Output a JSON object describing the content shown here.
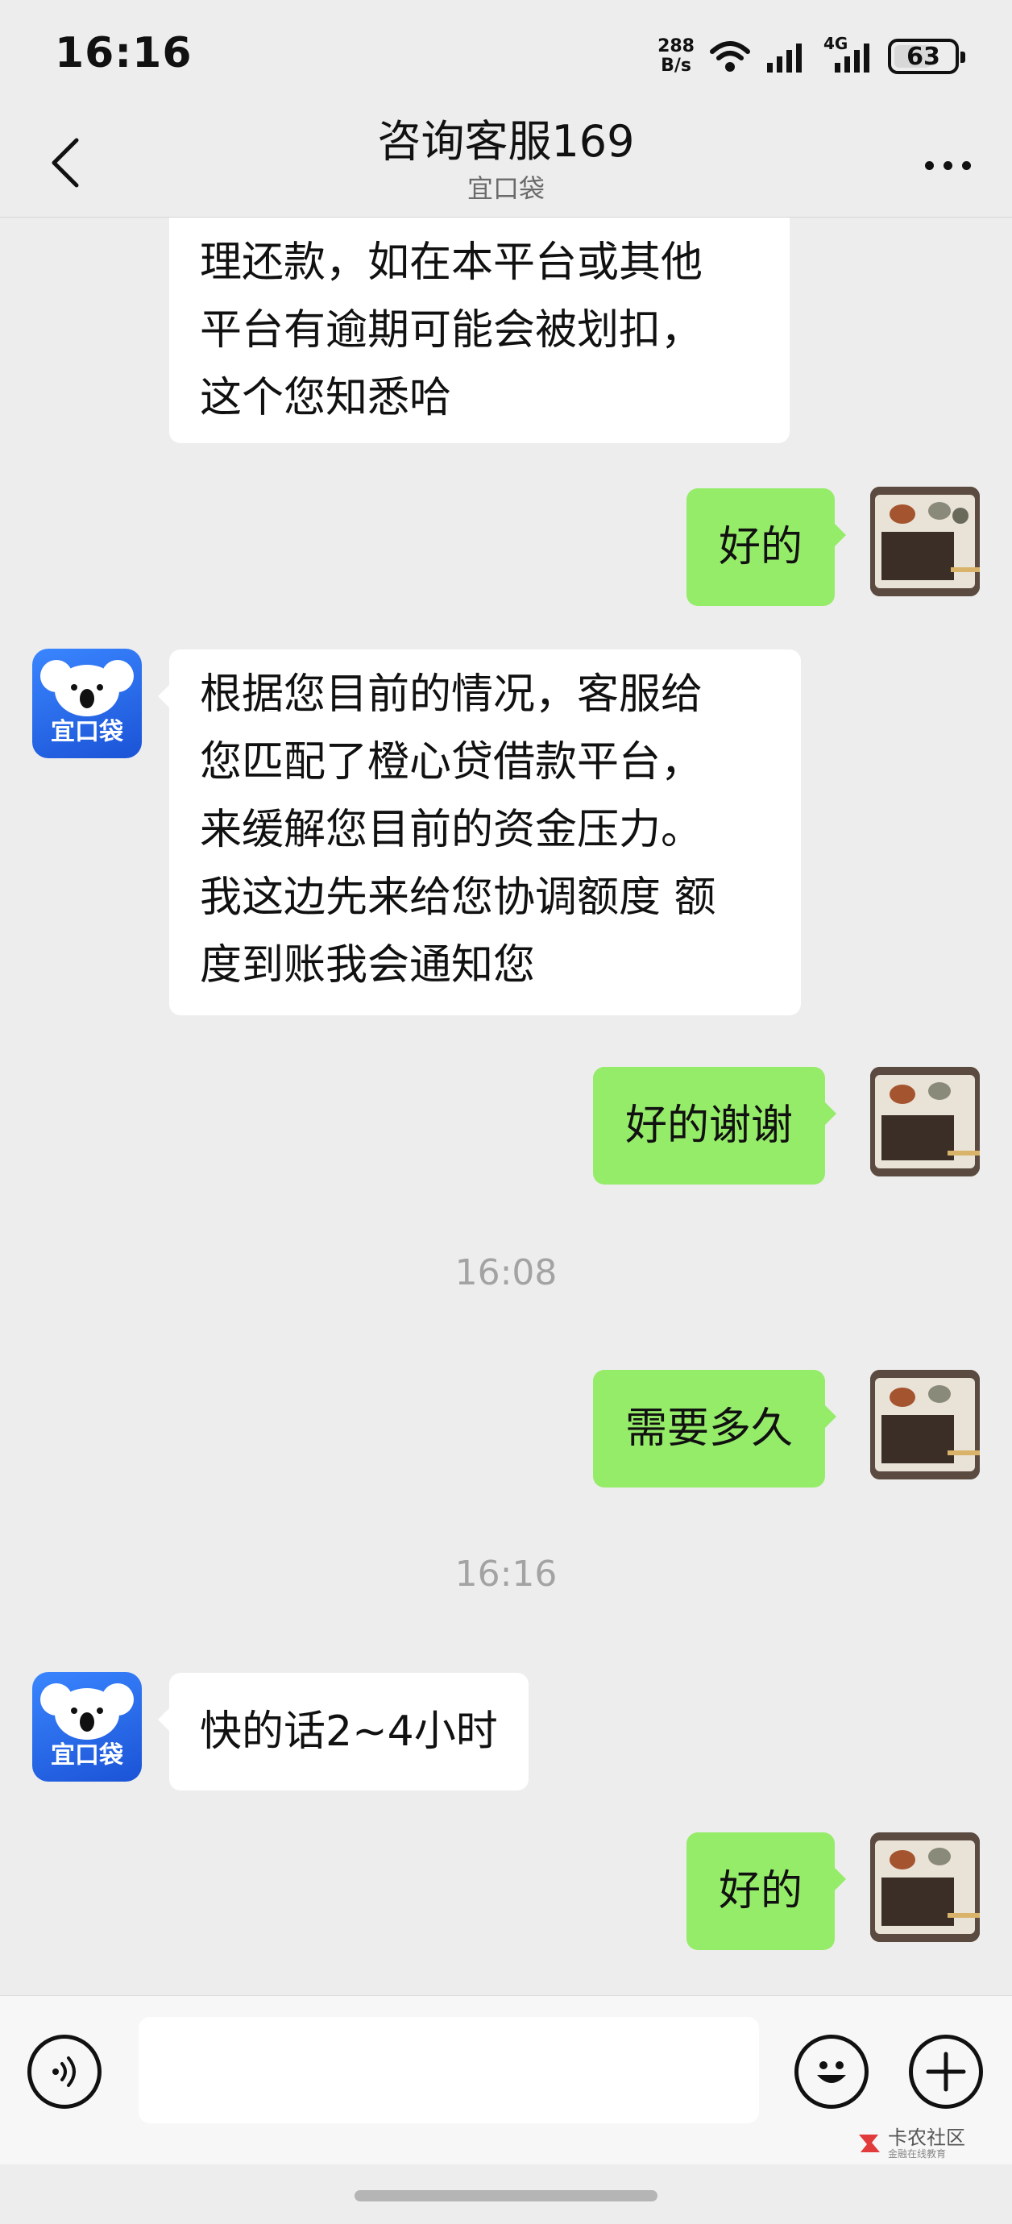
{
  "status_bar": {
    "time": "16:16",
    "net_speed_value": "288",
    "net_speed_unit": "B/s",
    "network_type": "4G",
    "battery_level": "63",
    "battery_fraction": 0.63
  },
  "nav": {
    "title": "咨询客服169",
    "subtitle": "宜口袋"
  },
  "brand": {
    "avatar_text": "宜口袋",
    "bubble_color_out": "#95ec69",
    "bubble_color_in": "#ffffff",
    "background": "#ededed"
  },
  "messages": [
    {
      "side": "in",
      "text": "理还款，如在本平台或其他\n平台有逾期可能会被划扣，\n这个您知悉哈"
    },
    {
      "side": "out",
      "text": "好的"
    },
    {
      "side": "in",
      "text": "根据您目前的情况，客服给\n您匹配了橙心贷借款平台，\n来缓解您目前的资金压力。\n我这边先来给您协调额度 额\n度到账我会通知您"
    },
    {
      "side": "out",
      "text": "好的谢谢"
    },
    {
      "side": "time",
      "text": "16:08"
    },
    {
      "side": "out",
      "text": "需要多久"
    },
    {
      "side": "time",
      "text": "16:16"
    },
    {
      "side": "in",
      "text": "快的话2~4小时"
    },
    {
      "side": "out",
      "text": "好的"
    }
  ],
  "input_bar": {
    "placeholder": "",
    "voice_icon": "voice-icon",
    "emoji_icon": "emoji-icon",
    "plus_icon": "plus-icon"
  },
  "watermark": {
    "main": "卡农社区",
    "sub": "金融在线教育"
  }
}
